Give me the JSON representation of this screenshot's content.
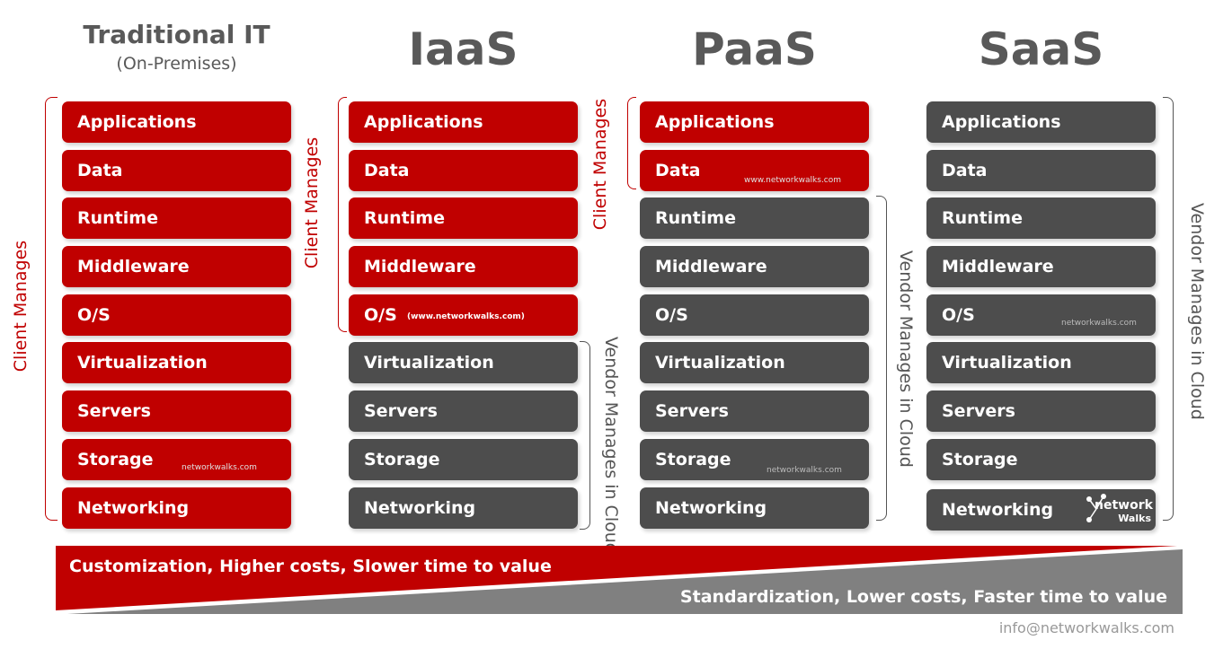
{
  "columns": [
    {
      "title": "Traditional IT",
      "subtitle": "(On-Premises)",
      "layers": [
        "Applications",
        "Data",
        "Runtime",
        "Middleware",
        "O/S",
        "Virtualization",
        "Servers",
        "Storage",
        "Networking"
      ],
      "client_count": 9
    },
    {
      "title": "IaaS",
      "layers": [
        "Applications",
        "Data",
        "Runtime",
        "Middleware",
        "O/S",
        "Virtualization",
        "Servers",
        "Storage",
        "Networking"
      ],
      "client_count": 5
    },
    {
      "title": "PaaS",
      "layers": [
        "Applications",
        "Data",
        "Runtime",
        "Middleware",
        "O/S",
        "Virtualization",
        "Servers",
        "Storage",
        "Networking"
      ],
      "client_count": 2
    },
    {
      "title": "SaaS",
      "layers": [
        "Applications",
        "Data",
        "Runtime",
        "Middleware",
        "O/S",
        "Virtualization",
        "Servers",
        "Storage",
        "Networking"
      ],
      "client_count": 0
    }
  ],
  "labels": {
    "client": "Client Manages",
    "vendor": "Vendor Manages in Cloud"
  },
  "watermarks": {
    "trad_storage": "networkwalks.com",
    "iaas_os": "(www.networkwalks.com)",
    "paas_data": "www.networkwalks.com",
    "paas_storage": "networkwalks.com",
    "saas_os": "networkwalks.com"
  },
  "logo": {
    "line1": "network",
    "line2": "Walks"
  },
  "banner": {
    "top": "Customization, Higher costs, Slower time to value",
    "bottom": "Standardization, Lower costs, Faster time to value"
  },
  "footer": "info@networkwalks.com",
  "colors": {
    "client": "#c00000",
    "vendor": "#4d4d4d",
    "bottom_banner": "#808080"
  }
}
